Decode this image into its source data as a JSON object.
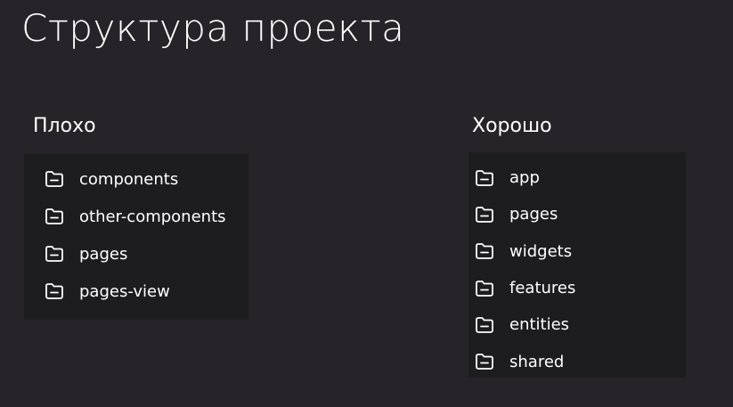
{
  "title": "Структура проекта",
  "bad": {
    "heading": "Плохо",
    "items": [
      {
        "label": "components",
        "icon": "folder-icon"
      },
      {
        "label": "other-components",
        "icon": "folder-icon"
      },
      {
        "label": "pages",
        "icon": "folder-icon"
      },
      {
        "label": "pages-view",
        "icon": "folder-icon"
      }
    ]
  },
  "good": {
    "heading": "Хорошо",
    "items": [
      {
        "label": "app",
        "icon": "folder-icon"
      },
      {
        "label": "pages",
        "icon": "folder-icon"
      },
      {
        "label": "widgets",
        "icon": "folder-icon"
      },
      {
        "label": "features",
        "icon": "folder-icon"
      },
      {
        "label": "entities",
        "icon": "folder-icon"
      },
      {
        "label": "shared",
        "icon": "folder-icon"
      }
    ]
  },
  "colors": {
    "background": "#262428",
    "panel": "#1d1d1f",
    "text": "#ffffff"
  }
}
